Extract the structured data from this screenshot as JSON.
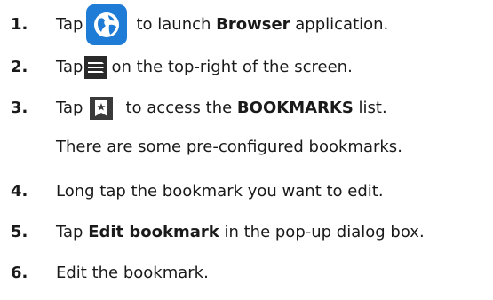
{
  "steps": [
    {
      "number": "1.",
      "pre": "Tap",
      "bold": "Browser",
      "post_a": "to launch ",
      "post_b": " application."
    },
    {
      "number": "2.",
      "pre": "Tap",
      "post": "on the top-right of the screen."
    },
    {
      "number": "3.",
      "pre": "Tap",
      "post_a": "to access the ",
      "bold": "BOOKMARKS",
      "post_b": " list.",
      "note": "There are some pre-configured bookmarks."
    },
    {
      "number": "4.",
      "text": "Long tap the bookmark you want to edit."
    },
    {
      "number": "5.",
      "pre": "Tap ",
      "bold": "Edit bookmark",
      "post": " in the pop-up dialog box."
    },
    {
      "number": "6.",
      "text": "Edit the bookmark."
    }
  ],
  "icons": {
    "step1": "globe-icon",
    "step2": "menu-icon",
    "step3": "bookmark-star-icon"
  },
  "colors": {
    "text": "#1a1a1a",
    "browser_icon": "#1e7bd6"
  }
}
